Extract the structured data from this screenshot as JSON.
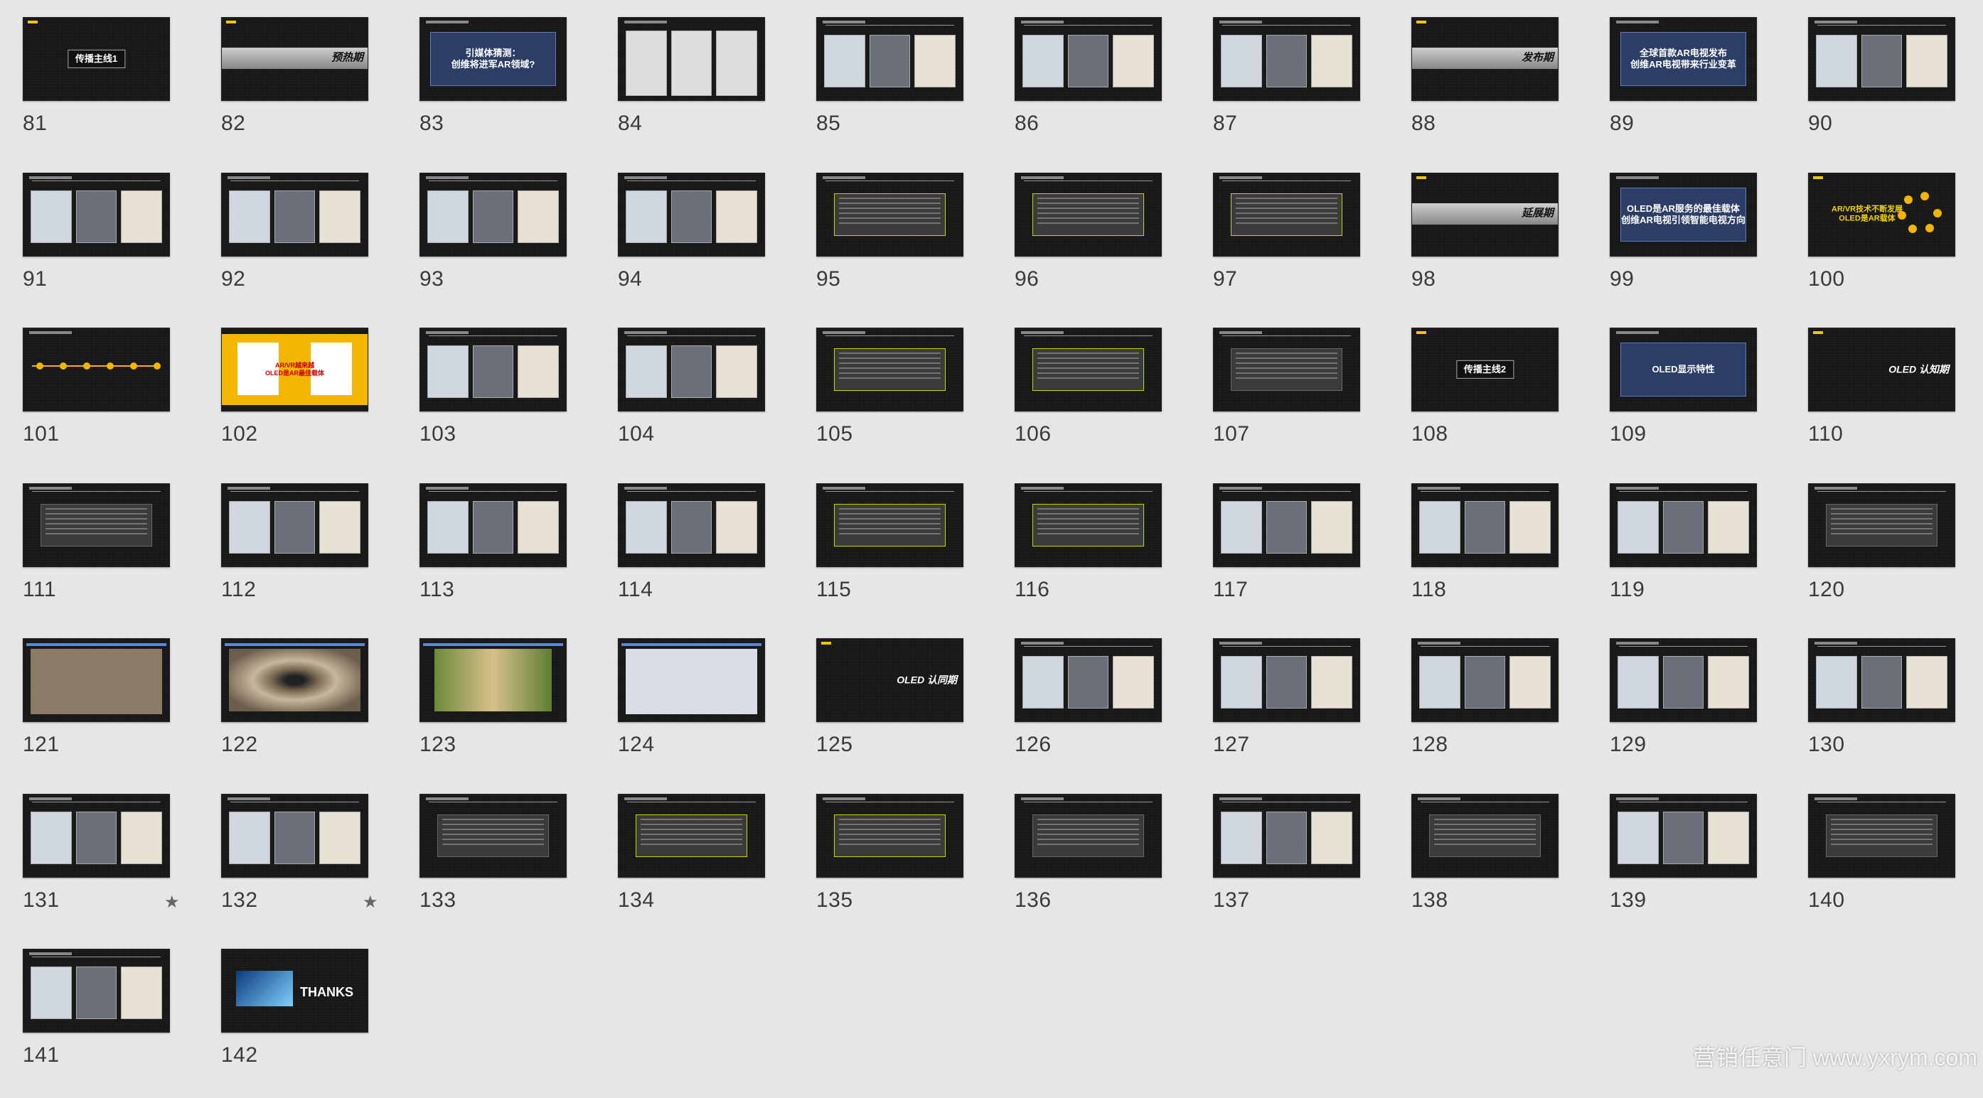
{
  "slides": [
    {
      "n": "81",
      "t": "title-box",
      "text": "传播主线1"
    },
    {
      "n": "82",
      "t": "band",
      "text": "预热期"
    },
    {
      "n": "83",
      "t": "blue-text",
      "text": "引媒体猜测：\n创维将进军AR领域?"
    },
    {
      "n": "84",
      "t": "white-cards"
    },
    {
      "n": "85",
      "t": "imgs"
    },
    {
      "n": "86",
      "t": "imgs"
    },
    {
      "n": "87",
      "t": "imgs"
    },
    {
      "n": "88",
      "t": "band",
      "text": "发布期"
    },
    {
      "n": "89",
      "t": "blue-text",
      "text": "全球首款AR电视发布\n创维AR电视带来行业变革"
    },
    {
      "n": "90",
      "t": "imgs"
    },
    {
      "n": "91",
      "t": "imgs"
    },
    {
      "n": "92",
      "t": "imgs"
    },
    {
      "n": "93",
      "t": "imgs"
    },
    {
      "n": "94",
      "t": "imgs"
    },
    {
      "n": "95",
      "t": "table",
      "g": true
    },
    {
      "n": "96",
      "t": "table",
      "g": true
    },
    {
      "n": "97",
      "t": "table",
      "g": true
    },
    {
      "n": "98",
      "t": "band",
      "text": "延展期"
    },
    {
      "n": "99",
      "t": "blue-text",
      "text": "OLED是AR服务的最佳载体\n创维AR电视引领智能电视方向"
    },
    {
      "n": "100",
      "t": "yellow-text",
      "text": "AR/VR技术不断发展\nOLED是AR载体"
    },
    {
      "n": "101",
      "t": "timeline"
    },
    {
      "n": "102",
      "t": "yellow-cards",
      "text": "AR/VR越来越\nOLED是AR最佳载体"
    },
    {
      "n": "103",
      "t": "imgs"
    },
    {
      "n": "104",
      "t": "imgs"
    },
    {
      "n": "105",
      "t": "table",
      "g": true
    },
    {
      "n": "106",
      "t": "table",
      "g": true
    },
    {
      "n": "107",
      "t": "table",
      "g": false
    },
    {
      "n": "108",
      "t": "title-box",
      "text": "传播主线2"
    },
    {
      "n": "109",
      "t": "blue-text",
      "text": "OLED显示特性"
    },
    {
      "n": "110",
      "t": "dark-text",
      "text": "OLED 认知期"
    },
    {
      "n": "111",
      "t": "table",
      "g": false
    },
    {
      "n": "112",
      "t": "imgs"
    },
    {
      "n": "113",
      "t": "imgs"
    },
    {
      "n": "114",
      "t": "imgs"
    },
    {
      "n": "115",
      "t": "table",
      "g": true
    },
    {
      "n": "116",
      "t": "table",
      "g": true
    },
    {
      "n": "117",
      "t": "imgs"
    },
    {
      "n": "118",
      "t": "imgs"
    },
    {
      "n": "119",
      "t": "imgs"
    },
    {
      "n": "120",
      "t": "table",
      "g": false
    },
    {
      "n": "121",
      "t": "photo",
      "c": "#8a7a66"
    },
    {
      "n": "122",
      "t": "eye"
    },
    {
      "n": "123",
      "t": "glasses"
    },
    {
      "n": "124",
      "t": "photo",
      "c": "#d9dee6"
    },
    {
      "n": "125",
      "t": "dark-text",
      "text": "OLED 认同期"
    },
    {
      "n": "126",
      "t": "imgs"
    },
    {
      "n": "127",
      "t": "imgs"
    },
    {
      "n": "128",
      "t": "imgs"
    },
    {
      "n": "129",
      "t": "imgs"
    },
    {
      "n": "130",
      "t": "imgs"
    },
    {
      "n": "131",
      "t": "imgs",
      "star": true
    },
    {
      "n": "132",
      "t": "imgs",
      "star": true
    },
    {
      "n": "133",
      "t": "table",
      "g": false
    },
    {
      "n": "134",
      "t": "table",
      "g": true
    },
    {
      "n": "135",
      "t": "table",
      "g": true
    },
    {
      "n": "136",
      "t": "table",
      "g": false
    },
    {
      "n": "137",
      "t": "imgs"
    },
    {
      "n": "138",
      "t": "table",
      "g": false
    },
    {
      "n": "139",
      "t": "imgs"
    },
    {
      "n": "140",
      "t": "table",
      "g": false
    },
    {
      "n": "141",
      "t": "imgs"
    },
    {
      "n": "142",
      "t": "thanks",
      "text": "THANKS"
    }
  ],
  "star_glyph": "★",
  "watermark": "营销任意门 www.yxrym.com"
}
